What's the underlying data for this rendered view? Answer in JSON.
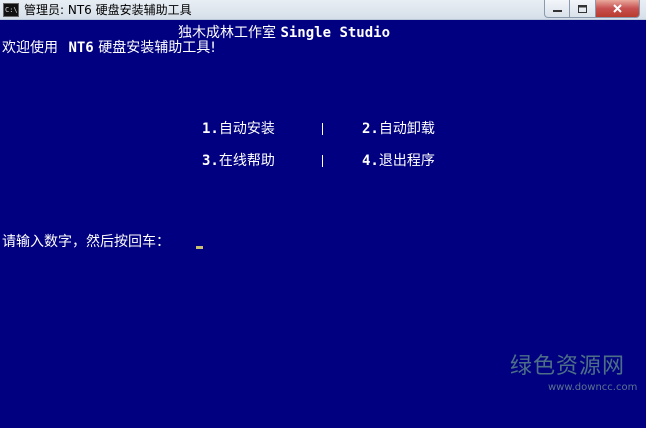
{
  "window": {
    "title": "管理员: NT6 硬盘安装辅助工具",
    "icon": "cmd-icon",
    "icon_text": "C:\\",
    "minimize": "minimize-icon",
    "maximize": "maximize-icon",
    "close": "close-icon"
  },
  "console": {
    "header_cn": "独木成林工作室",
    "header_en": "Single Studio",
    "welcome_prefix": "欢迎使用",
    "welcome_app": "NT6",
    "welcome_suffix": "硬盘安装辅助工具!",
    "menu": [
      {
        "num": "1.",
        "label": "自动安装"
      },
      {
        "num": "2.",
        "label": "自动卸载"
      },
      {
        "num": "3.",
        "label": "在线帮助"
      },
      {
        "num": "4.",
        "label": "退出程序"
      }
    ],
    "prompt": "请输入数字，然后按回车："
  },
  "watermark": {
    "name": "绿色资源网",
    "url": "www.downcc.com"
  },
  "colors": {
    "console_bg": "#000080",
    "console_fg": "#ffffff",
    "cursor": "#c8c070"
  }
}
